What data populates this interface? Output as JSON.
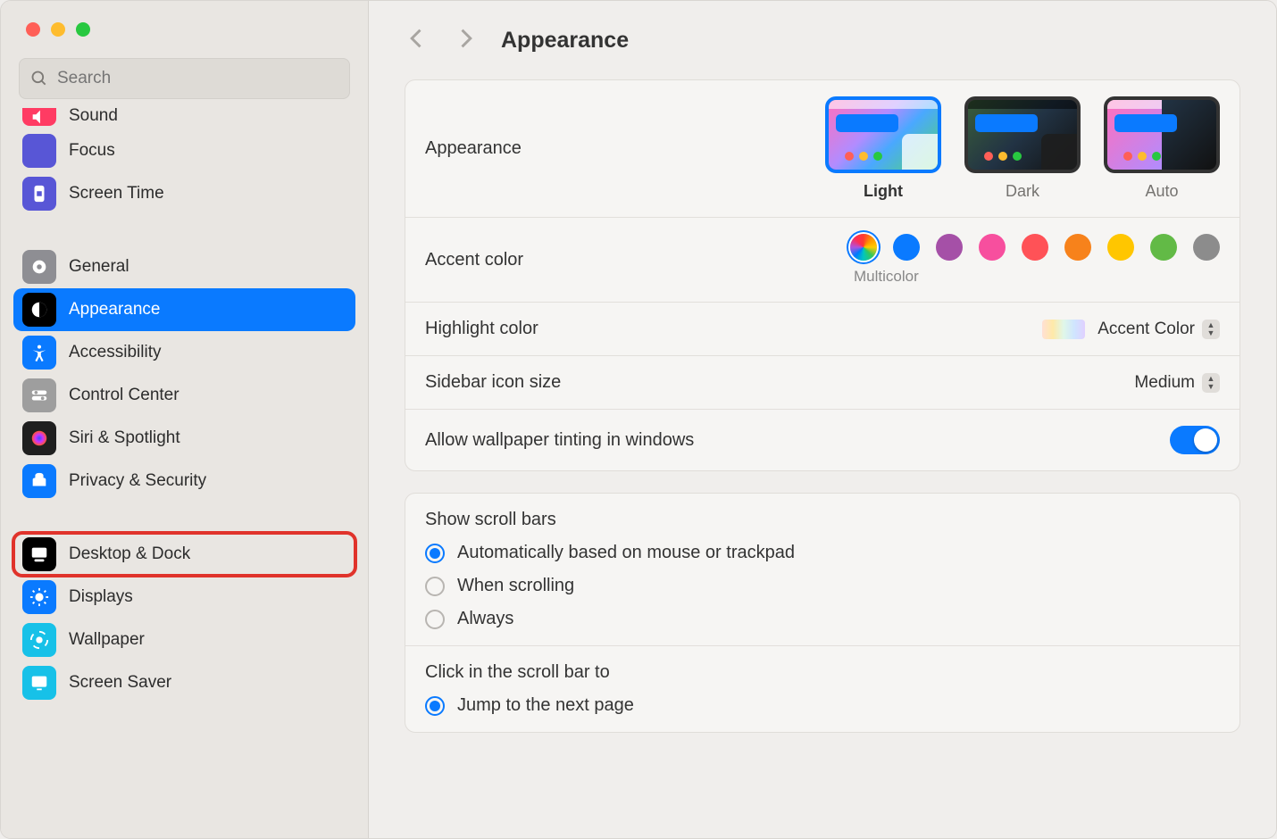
{
  "search": {
    "placeholder": "Search"
  },
  "header": {
    "title": "Appearance"
  },
  "sidebar": {
    "partial_top": "Sound",
    "items": [
      {
        "label": "Focus",
        "icon": "focus-icon",
        "iconClass": "i-focus"
      },
      {
        "label": "Screen Time",
        "icon": "screentime-icon",
        "iconClass": "i-screentime"
      },
      {
        "label": "General",
        "icon": "general-icon",
        "iconClass": "i-general",
        "spacerBefore": true
      },
      {
        "label": "Appearance",
        "icon": "appearance-icon",
        "iconClass": "i-appearance",
        "selected": true
      },
      {
        "label": "Accessibility",
        "icon": "accessibility-icon",
        "iconClass": "i-access"
      },
      {
        "label": "Control Center",
        "icon": "controlcenter-icon",
        "iconClass": "i-cc"
      },
      {
        "label": "Siri & Spotlight",
        "icon": "siri-icon",
        "iconClass": "i-siri"
      },
      {
        "label": "Privacy & Security",
        "icon": "privacy-icon",
        "iconClass": "i-privacy"
      },
      {
        "label": "Desktop & Dock",
        "icon": "desktop-icon",
        "iconClass": "i-desktop",
        "spacerBefore": true,
        "highlighted": true
      },
      {
        "label": "Displays",
        "icon": "displays-icon",
        "iconClass": "i-displays"
      },
      {
        "label": "Wallpaper",
        "icon": "wallpaper-icon",
        "iconClass": "i-wallpaper"
      },
      {
        "label": "Screen Saver",
        "icon": "screensaver-icon",
        "iconClass": "i-screensaver"
      }
    ]
  },
  "appearance_section": {
    "label": "Appearance",
    "options": [
      {
        "label": "Light",
        "selected": true,
        "kind": "light"
      },
      {
        "label": "Dark",
        "selected": false,
        "kind": "dark"
      },
      {
        "label": "Auto",
        "selected": false,
        "kind": "auto"
      }
    ]
  },
  "accent": {
    "label": "Accent color",
    "caption": "Multicolor",
    "colors": [
      {
        "name": "multicolor",
        "css": "multi",
        "selected": true
      },
      {
        "name": "blue",
        "css": "#0a7aff"
      },
      {
        "name": "purple",
        "css": "#a550a7"
      },
      {
        "name": "pink",
        "css": "#f74f9e"
      },
      {
        "name": "red",
        "css": "#ff5257"
      },
      {
        "name": "orange",
        "css": "#f7821b"
      },
      {
        "name": "yellow",
        "css": "#ffc600"
      },
      {
        "name": "green",
        "css": "#62ba46"
      },
      {
        "name": "graphite",
        "css": "#8c8c8c"
      }
    ]
  },
  "highlight": {
    "label": "Highlight color",
    "value": "Accent Color"
  },
  "sidebar_icon_size": {
    "label": "Sidebar icon size",
    "value": "Medium"
  },
  "tinting": {
    "label": "Allow wallpaper tinting in windows",
    "enabled": true
  },
  "scroll": {
    "show_label": "Show scroll bars",
    "show_options": [
      {
        "label": "Automatically based on mouse or trackpad",
        "selected": true
      },
      {
        "label": "When scrolling",
        "selected": false
      },
      {
        "label": "Always",
        "selected": false
      }
    ],
    "click_label": "Click in the scroll bar to",
    "click_options": [
      {
        "label": "Jump to the next page",
        "selected": true
      }
    ]
  }
}
